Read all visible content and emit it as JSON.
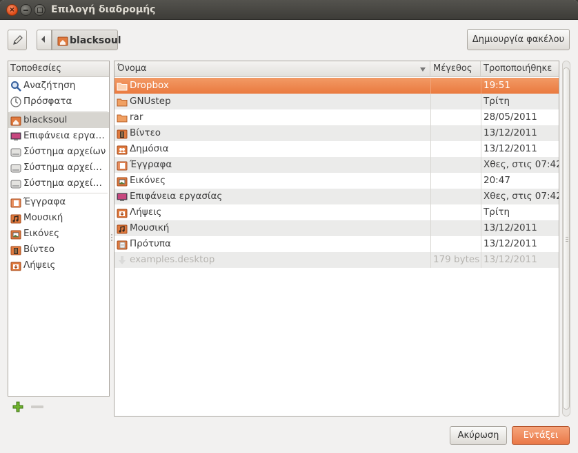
{
  "window": {
    "title": "Επιλογή διαδρομής"
  },
  "toolbar": {
    "path_label": "blacksoul",
    "new_folder_label": "Δημιουργία φακέλου"
  },
  "places": {
    "header": "Τοποθεσίες",
    "items": [
      {
        "label": "Αναζήτηση",
        "icon": "search-icon"
      },
      {
        "label": "Πρόσφατα",
        "icon": "clock-icon"
      },
      {
        "label": "blacksoul",
        "icon": "home-folder-icon",
        "selected": true
      },
      {
        "label": "Επιφάνεια εργα…",
        "icon": "desktop-icon"
      },
      {
        "label": "Σύστημα αρχείων",
        "icon": "drive-icon"
      },
      {
        "label": "Σύστημα αρχεί…",
        "icon": "drive-icon"
      },
      {
        "label": "Σύστημα αρχεί…",
        "icon": "drive-icon"
      },
      {
        "label": "Έγγραφα",
        "icon": "documents-folder-icon"
      },
      {
        "label": "Μουσική",
        "icon": "music-folder-icon"
      },
      {
        "label": "Εικόνες",
        "icon": "pictures-folder-icon"
      },
      {
        "label": "Βίντεο",
        "icon": "video-folder-icon"
      },
      {
        "label": "Λήψεις",
        "icon": "downloads-folder-icon"
      }
    ]
  },
  "files": {
    "columns": {
      "name": "Όνομα",
      "size": "Μέγεθος",
      "modified": "Τροποποιήθηκε"
    },
    "rows": [
      {
        "name": "Dropbox",
        "size": "",
        "modified": "19:51",
        "icon": "folder-icon",
        "selected": true
      },
      {
        "name": "GNUstep",
        "size": "",
        "modified": "Τρίτη",
        "icon": "folder-icon"
      },
      {
        "name": "rar",
        "size": "",
        "modified": "28/05/2011",
        "icon": "folder-icon"
      },
      {
        "name": "Βίντεο",
        "size": "",
        "modified": "13/12/2011",
        "icon": "video-folder-icon"
      },
      {
        "name": "Δημόσια",
        "size": "",
        "modified": "13/12/2011",
        "icon": "public-folder-icon"
      },
      {
        "name": "Έγγραφα",
        "size": "",
        "modified": "Χθες, στις 07:42",
        "icon": "documents-folder-icon"
      },
      {
        "name": "Εικόνες",
        "size": "",
        "modified": "20:47",
        "icon": "pictures-folder-icon"
      },
      {
        "name": "Επιφάνεια εργασίας",
        "size": "",
        "modified": "Χθες, στις 07:42",
        "icon": "desktop-icon"
      },
      {
        "name": "Λήψεις",
        "size": "",
        "modified": "Τρίτη",
        "icon": "downloads-folder-icon"
      },
      {
        "name": "Μουσική",
        "size": "",
        "modified": "13/12/2011",
        "icon": "music-folder-icon"
      },
      {
        "name": "Πρότυπα",
        "size": "",
        "modified": "13/12/2011",
        "icon": "templates-folder-icon"
      },
      {
        "name": "examples.desktop",
        "size": "179 bytes",
        "modified": "13/12/2011",
        "icon": "desktop-file-icon",
        "dimmed": true
      }
    ]
  },
  "buttons": {
    "cancel": "Ακύρωση",
    "ok": "Εντάξει"
  },
  "colors": {
    "accent": "#ea7a3f",
    "titlebar": "#3d3c38",
    "window_bg": "#f2f1f0"
  }
}
